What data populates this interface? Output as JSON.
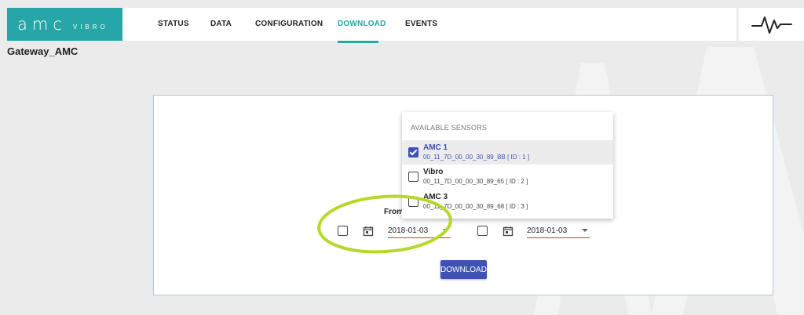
{
  "brand": {
    "name": "amc",
    "sub": "VIBRO"
  },
  "nav": {
    "status": "STATUS",
    "data": "DATA",
    "configuration": "CONFIGURATION",
    "download": "DOWNLOAD",
    "events": "EVENTS"
  },
  "gateway": {
    "title": "Gateway_AMC"
  },
  "form": {
    "from_label": "From",
    "from_date": "2018-01-03",
    "to_date": "2018-01-03",
    "download_label": "DOWNLOAD"
  },
  "sensors": {
    "header": "AVAILABLE SENSORS",
    "items": [
      {
        "name": "AMC 1",
        "id_text": "00_11_7D_00_00_30_89_BB [ ID : 1 ]",
        "checked": true
      },
      {
        "name": "Vibro",
        "id_text": "00_11_7D_00_00_30_89_65 [ ID : 2 ]",
        "checked": false
      },
      {
        "name": "AMC 3",
        "id_text": "00_11_7D_00_00_30_89_68 [ ID : 3 ]",
        "checked": false
      }
    ]
  },
  "colors": {
    "brand": "#26a6a6",
    "accent": "#3f51b5",
    "highlight_ellipse": "#b5d929",
    "date_underline": "#dd3333"
  }
}
